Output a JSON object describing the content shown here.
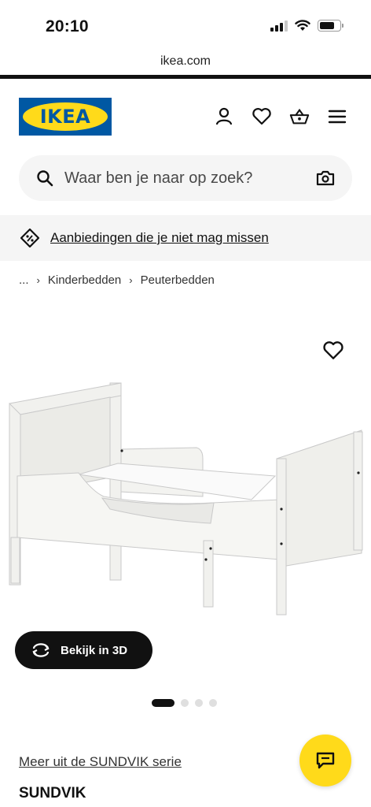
{
  "status_bar": {
    "time": "20:10",
    "battery_level": 0.75
  },
  "browser": {
    "url": "ikea.com"
  },
  "header": {
    "logo_text": "IKEA",
    "icons": [
      "account-icon",
      "heart-icon",
      "basket-icon",
      "menu-icon"
    ]
  },
  "search": {
    "placeholder": "Waar ben je naar op zoek?"
  },
  "promo": {
    "text": "Aanbiedingen die je niet mag missen"
  },
  "breadcrumb": {
    "ellipsis": "...",
    "items": [
      "Kinderbedden",
      "Peuterbedden"
    ]
  },
  "product": {
    "view_3d_label": "Bekijk in 3D",
    "image_count": 4,
    "active_image": 1,
    "series_link": "Meer uit de SUNDVIK serie",
    "name": "SUNDVIK"
  },
  "colors": {
    "ikea_blue": "#0058a3",
    "ikea_yellow": "#ffda1a"
  }
}
